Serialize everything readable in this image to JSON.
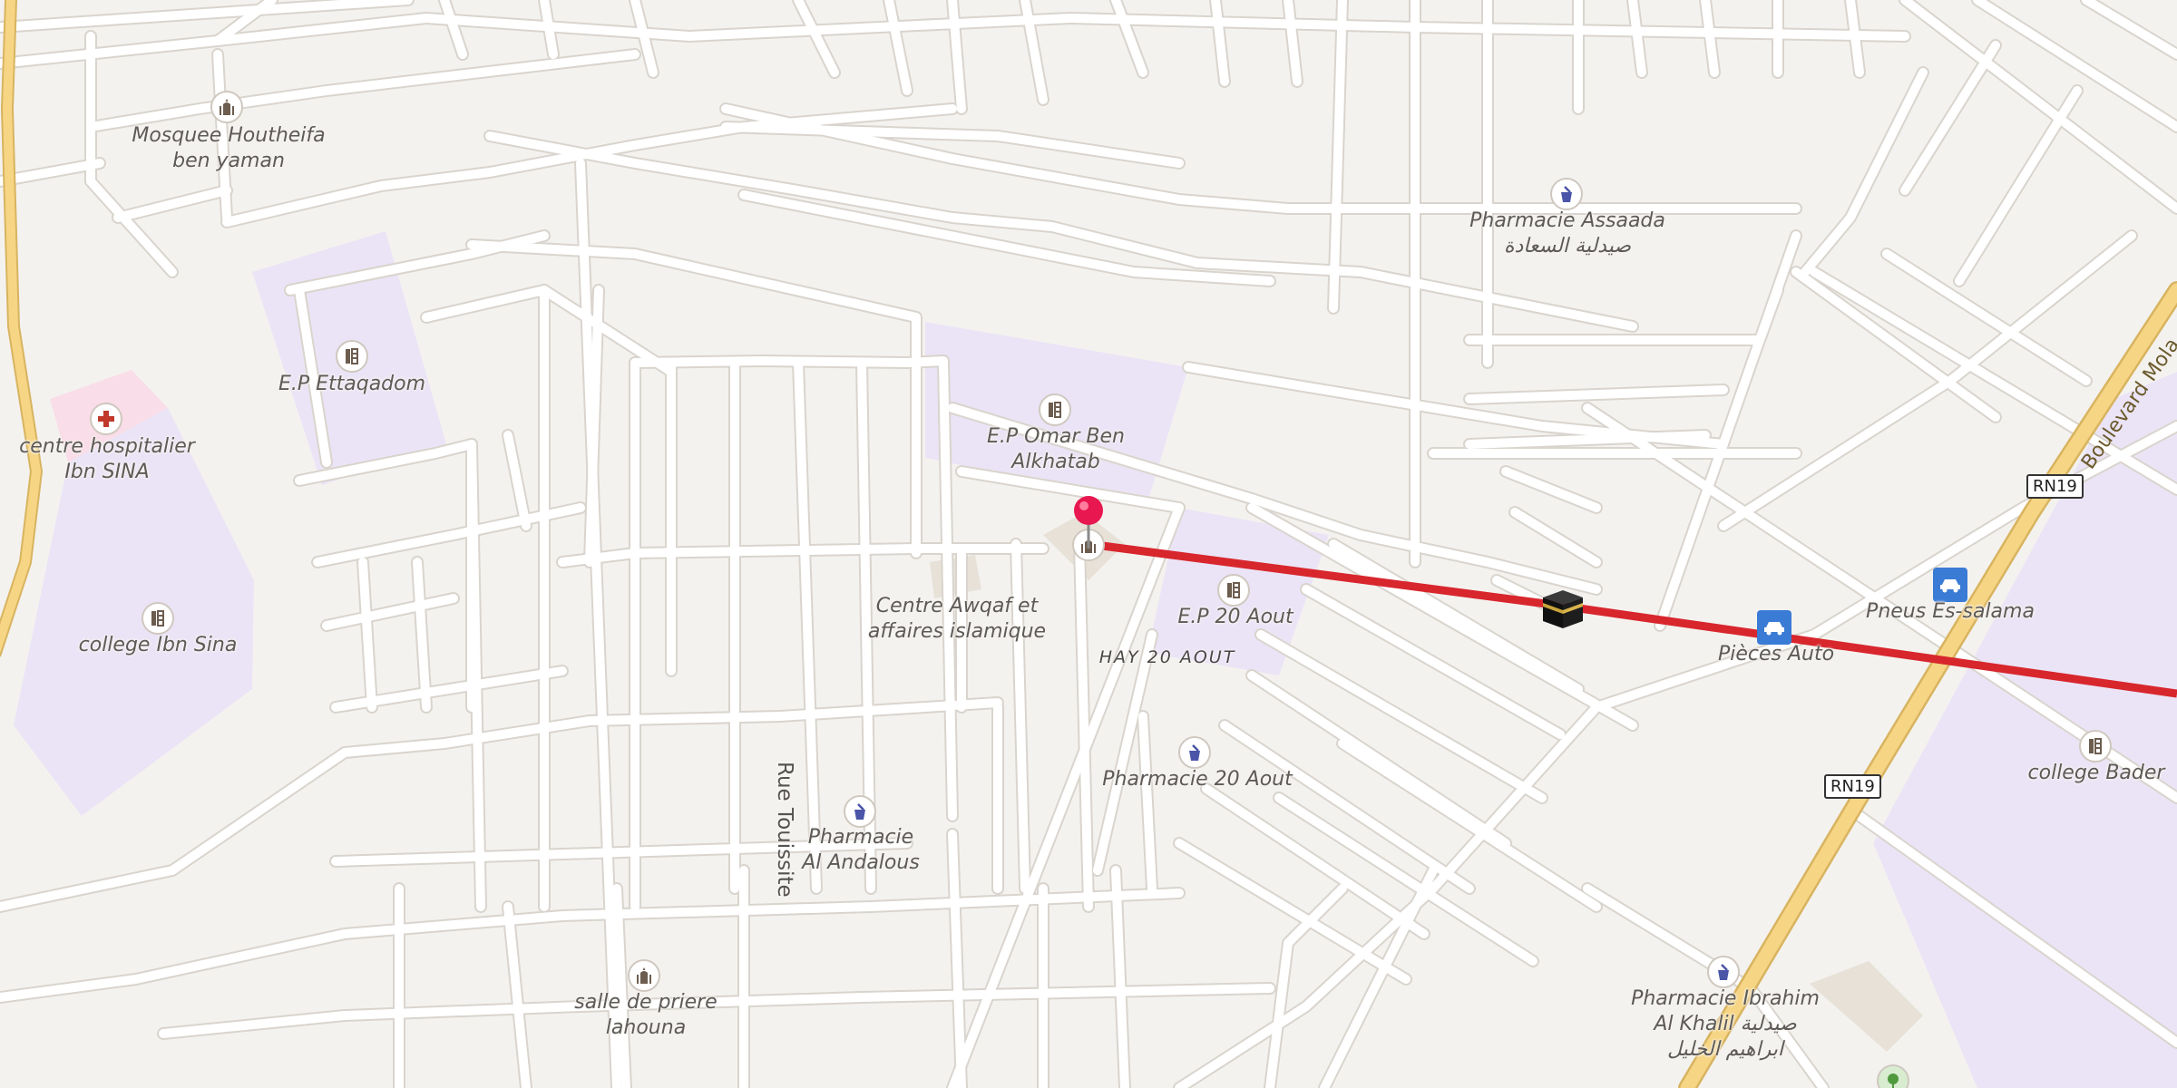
{
  "labels": {
    "mosquee_houtheifa": "Mosquee Houtheifa\nben yaman",
    "ep_ettaqadom": "E.P Ettaqadom",
    "centre_hospitalier": "centre hospitalier\nIbn SINA",
    "college_ibn_sina": "college Ibn Sina",
    "ep_omar": "E.P Omar Ben\nAlkhatab",
    "centre_awqaf": "Centre Awqaf et\naffaires islamique",
    "ep_20_aout": "E.P 20 Aout",
    "pharmacie_assaada": "Pharmacie Assaada\nصيدلية السعادة",
    "pharmacie_20_aout": "Pharmacie 20 Aout",
    "pharmacie_andalous": "Pharmacie\nAl Andalous",
    "salle_priere": "salle de priere\nlahouna",
    "pieces_auto": "Pièces Auto",
    "pneus": "Pneus Es-salama",
    "college_bader": "college Bader",
    "pharmacie_ibrahim": "Pharmacie Ibrahim\nAl Khalil صيدلية\nابراهيم الخليل"
  },
  "district": "HAY 20 AOUT",
  "street_rue_touissite": "Rue Touissite",
  "street_boulevard": "Boulevard Mola",
  "road_shields": [
    "RN19",
    "RN19"
  ],
  "colors": {
    "background": "#f4f2ef",
    "road": "#ffffff",
    "road_casing": "#d9d4cd",
    "school_area": "#ebe4f6",
    "hospital_area": "#f9dde8",
    "highway": "#f6d585",
    "route_line": "#d8262d",
    "pin": "#e8174f",
    "pharmacy_icon": "#4a55a8"
  },
  "icons": {
    "pin": "location-pin-icon",
    "destination": "kaaba-icon",
    "school": "school-icon",
    "mosque": "mosque-icon",
    "hospital": "hospital-cross-icon",
    "pharmacy": "pharmacy-icon",
    "car": "car-icon"
  }
}
